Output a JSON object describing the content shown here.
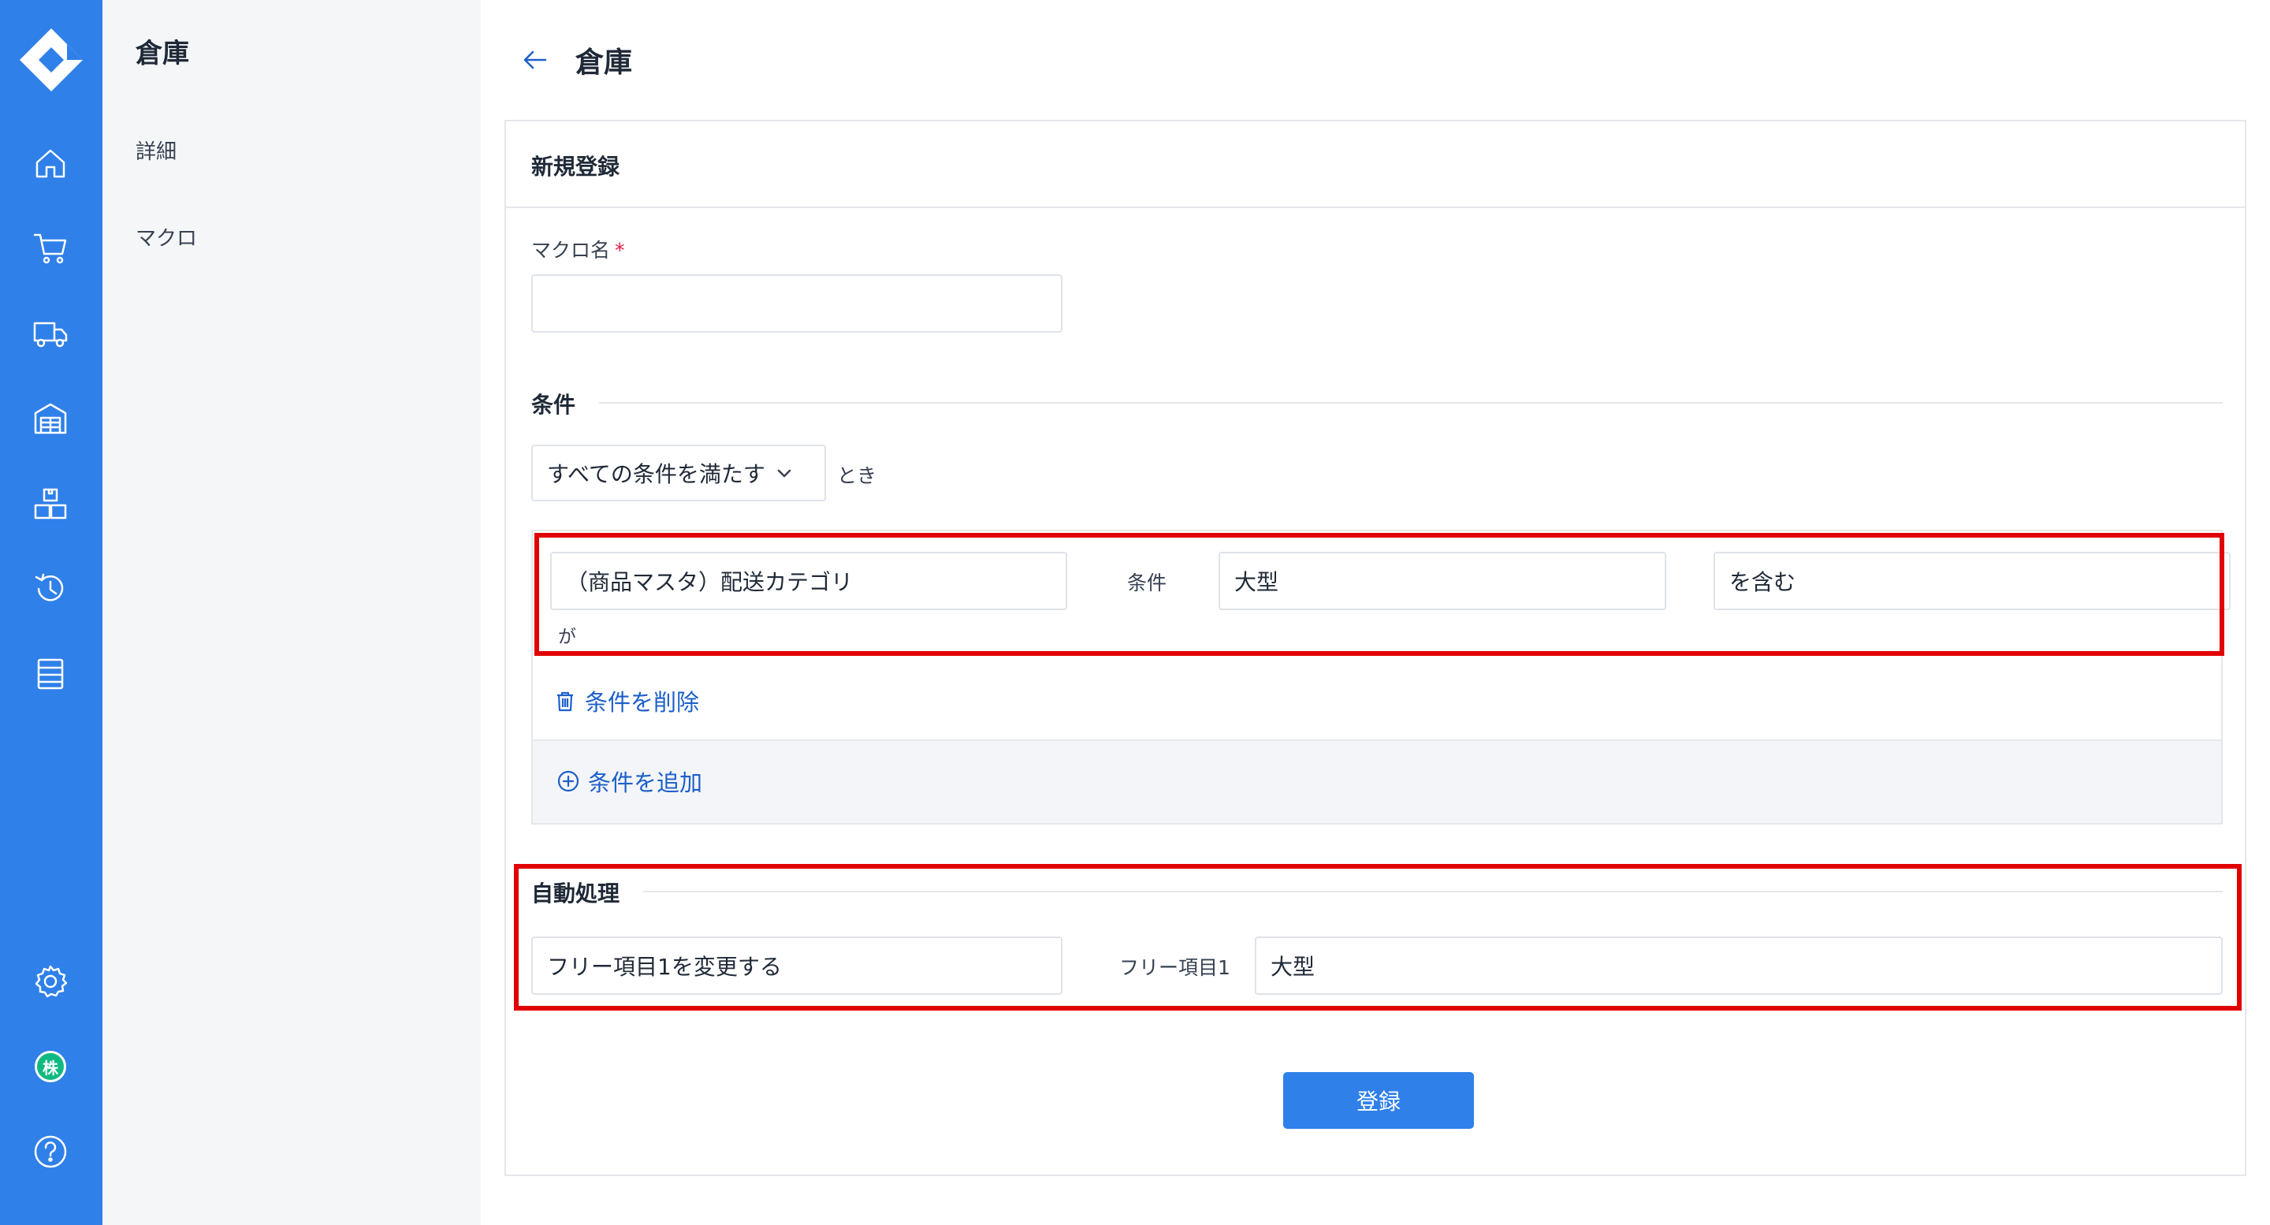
{
  "rail": {
    "brand_color": "#2f80e8",
    "avatar_label": "株",
    "icons": [
      "logo-icon",
      "home-icon",
      "cart-icon",
      "truck-icon",
      "warehouse-icon",
      "inventory-icon",
      "history-icon",
      "ledger-icon",
      "settings-icon",
      "avatar",
      "help-icon"
    ]
  },
  "subnav": {
    "title": "倉庫",
    "items": [
      {
        "label": "詳細"
      },
      {
        "label": "マクロ"
      }
    ]
  },
  "header": {
    "title": "倉庫"
  },
  "card": {
    "title": "新規登録",
    "macro_name": {
      "label": "マクロ名",
      "required_mark": "*",
      "value": ""
    },
    "conditions": {
      "title": "条件",
      "match_mode": "すべての条件を満たす",
      "match_suffix": "とき",
      "rule": {
        "field": "（商品マスタ）配送カテゴリ",
        "field_suffix": "が",
        "operator_label": "条件",
        "value": "大型",
        "operator": "を含む"
      },
      "delete_label": "条件を削除",
      "add_label": "条件を追加"
    },
    "actions": {
      "title": "自動処理",
      "action": "フリー項目1を変更する",
      "target_label": "フリー項目1",
      "target_value": "大型"
    },
    "submit_label": "登録"
  },
  "highlight_color": "#e00000"
}
